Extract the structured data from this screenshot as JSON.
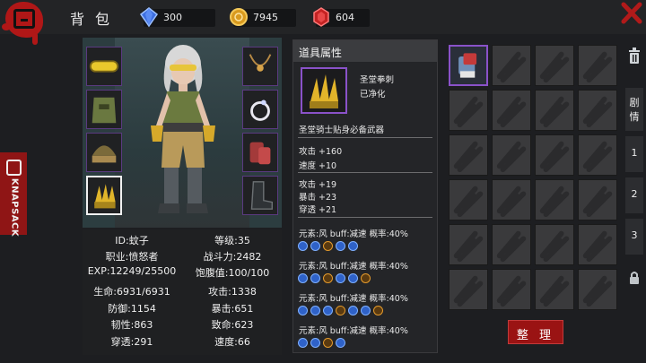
{
  "header": {
    "title": "背包",
    "gems": "300",
    "coins": "7945",
    "rubies": "604"
  },
  "side_tab": {
    "label": "KNAPSACK"
  },
  "character": {
    "stats": {
      "id": "ID:蚊子",
      "level": "等级:35",
      "job": "职业:愤怒者",
      "power": "战斗力:2482",
      "exp": "EXP:12249/25500",
      "satiety": "饱腹值:100/100",
      "hp": "生命:6931/6931",
      "attack": "攻击:1338",
      "defense": "防御:1154",
      "crit": "暴击:651",
      "toughness": "韧性:863",
      "fatal": "致命:623",
      "pierce": "穿透:291",
      "speed": "速度:66"
    }
  },
  "item_panel": {
    "header": "道具属性",
    "name": "圣堂拳刺",
    "state": "已净化",
    "desc": "圣堂骑士贴身必备武器",
    "base": [
      "攻击 +160",
      "速度 +10"
    ],
    "bonus": [
      "攻击 +19",
      "暴击 +23",
      "穿透 +21"
    ],
    "buffs": [
      "元素:风 buff:减速 概率:40%",
      "元素:风 buff:减速 概率:40%",
      "元素:风 buff:减速 概率:40%",
      "元素:风 buff:减速 概率:40%"
    ]
  },
  "inventory": {
    "sort_label": "整 理"
  },
  "right_tabs": {
    "story": "剧情",
    "t1": "1",
    "t2": "2",
    "t3": "3"
  },
  "colors": {
    "accent_red": "#9a1313",
    "rarity_purple": "#8a52c9",
    "buff_blue": "#2f62c8",
    "buff_orange": "#e49a2c"
  }
}
